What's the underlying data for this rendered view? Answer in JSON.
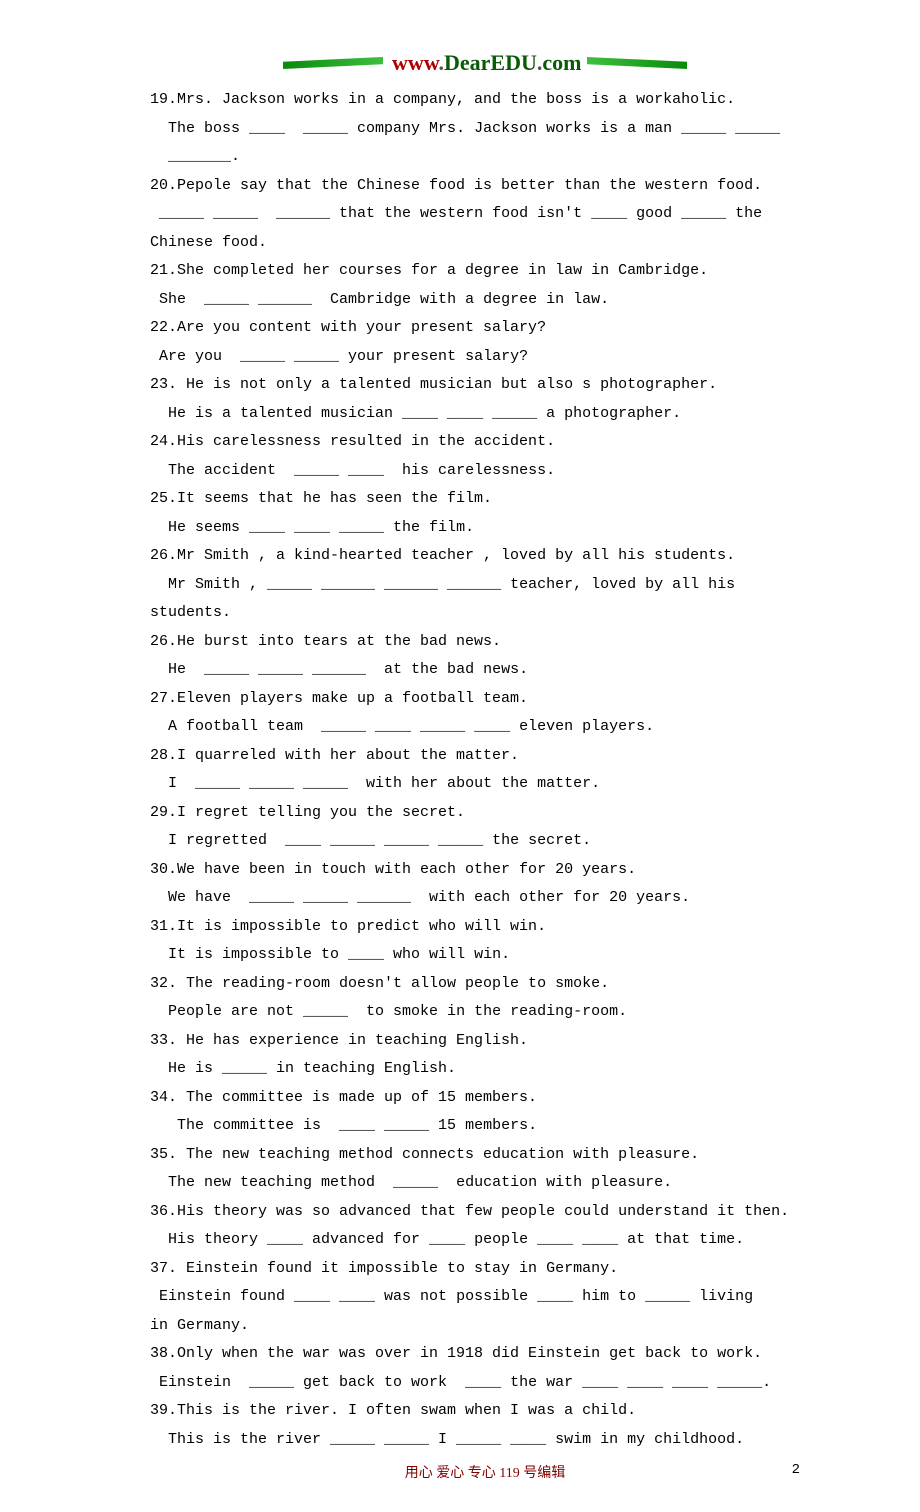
{
  "logo": {
    "part1": "www",
    "dot": ".",
    "part2": "DearEDU",
    "part3": "com"
  },
  "body": "19.Mrs. Jackson works in a company, and the boss is a workaholic.\n  The boss ____  _____ company Mrs. Jackson works is a man _____ _____\n  _______.\n20.Pepole say that the Chinese food is better than the western food.\n _____ _____  ______ that the western food isn't ____ good _____ the Chinese food.\n21.She completed her courses for a degree in law in Cambridge.\n She  _____ ______  Cambridge with a degree in law.\n22.Are you content with your present salary?\n Are you  _____ _____ your present salary?\n23. He is not only a talented musician but also s photographer.\n  He is a talented musician ____ ____ _____ a photographer.\n24.His carelessness resulted in the accident.\n  The accident  _____ ____  his carelessness.\n25.It seems that he has seen the film.\n  He seems ____ ____ _____ the film.\n26.Mr Smith , a kind-hearted teacher , loved by all his students.\n  Mr Smith , _____ ______ ______ ______ teacher, loved by all his students.\n26.He burst into tears at the bad news.\n  He  _____ _____ ______  at the bad news.\n27.Eleven players make up a football team.\n  A football team  _____ ____ _____ ____ eleven players.\n28.I quarreled with her about the matter.\n  I  _____ _____ _____  with her about the matter.\n29.I regret telling you the secret.\n  I regretted  ____ _____ _____ _____ the secret.\n30.We have been in touch with each other for 20 years.\n  We have  _____ _____ ______  with each other for 20 years.\n31.It is impossible to predict who will win.\n  It is impossible to ____ who will win.\n32. The reading-room doesn't allow people to smoke.\n  People are not _____  to smoke in the reading-room.\n33. He has experience in teaching English.\n  He is _____ in teaching English.\n34. The committee is made up of 15 members.\n   The committee is  ____ _____ 15 members.\n35. The new teaching method connects education with pleasure.\n  The new teaching method  _____  education with pleasure.\n36.His theory was so advanced that few people could understand it then.\n  His theory ____ advanced for ____ people ____ ____ at that time.\n37. Einstein found it impossible to stay in Germany.\n Einstein found ____ ____ was not possible ____ him to _____ living\nin Germany.\n38.Only when the war was over in 1918 did Einstein get back to work.\n Einstein  _____ get back to work  ____ the war ____ ____ ____ _____.\n39.This is the river. I often swam when I was a child.\n  This is the river _____ _____ I _____ ____ swim in my childhood.",
  "footer": {
    "text": "用心 爱心 专心  119 号编辑",
    "page": "2"
  }
}
